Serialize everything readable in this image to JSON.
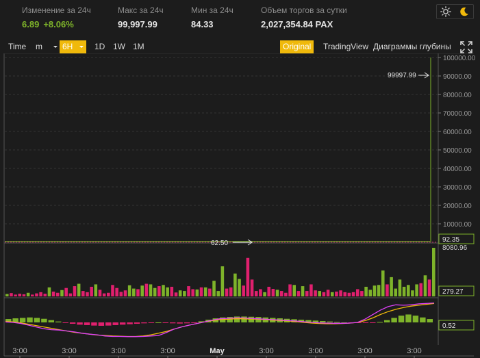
{
  "stats": [
    {
      "label": "Изменение за 24ч",
      "value": "6.89",
      "value2": "+8.06%"
    },
    {
      "label": "Макс за 24ч",
      "value": "99,997.99"
    },
    {
      "label": "Мин за 24ч",
      "value": "84.33"
    },
    {
      "label": "Объем торгов за сутки",
      "value": "2,027,354.84 PAX"
    }
  ],
  "theme_toggle": {
    "light_icon": "sun-icon",
    "dark_icon": "moon-icon"
  },
  "toolbar": {
    "time_label": "Time",
    "minute_select": "m",
    "hour_select": "6H",
    "day": "1D",
    "week": "1W",
    "month": "1M",
    "views": [
      "Original",
      "TradingView",
      "Диаграммы глубины"
    ],
    "active_view": "Original",
    "expand_icon": "expand-icon"
  },
  "colors": {
    "up": "#7eb32a",
    "down": "#e0206e",
    "accent": "#f0b90b",
    "ma_fast": "#e040fb",
    "ma_slow": "#f0b90b"
  },
  "chart_data": {
    "type": "candlestick",
    "price_axis": {
      "ticks": [
        "100000.00",
        "90000.00",
        "80000.00",
        "70000.00",
        "60000.00",
        "50000.00",
        "40000.00",
        "30000.00",
        "20000.00",
        "10000.00"
      ],
      "ylim": [
        0,
        100000
      ]
    },
    "max_marker": "99997.99",
    "min_marker": "62.50",
    "last_price": "92.35",
    "last_price_value": 92.35,
    "volume_panel": {
      "max_label": "8080.96",
      "current_label": "279.27",
      "max": 8080.96,
      "bars": [
        {
          "v": 400,
          "up": true
        },
        {
          "v": 550,
          "up": false
        },
        {
          "v": 300,
          "up": false
        },
        {
          "v": 450,
          "up": false
        },
        {
          "v": 350,
          "up": false
        },
        {
          "v": 600,
          "up": true
        },
        {
          "v": 300,
          "up": false
        },
        {
          "v": 500,
          "up": false
        },
        {
          "v": 700,
          "up": false
        },
        {
          "v": 450,
          "up": false
        },
        {
          "v": 1500,
          "up": true
        },
        {
          "v": 800,
          "up": false
        },
        {
          "v": 600,
          "up": false
        },
        {
          "v": 1050,
          "up": true
        },
        {
          "v": 1400,
          "up": false
        },
        {
          "v": 500,
          "up": false
        },
        {
          "v": 1700,
          "up": false
        },
        {
          "v": 2100,
          "up": true
        },
        {
          "v": 900,
          "up": false
        },
        {
          "v": 700,
          "up": false
        },
        {
          "v": 1600,
          "up": false
        },
        {
          "v": 2000,
          "up": true
        },
        {
          "v": 1100,
          "up": false
        },
        {
          "v": 500,
          "up": false
        },
        {
          "v": 600,
          "up": false
        },
        {
          "v": 1900,
          "up": false
        },
        {
          "v": 1400,
          "up": false
        },
        {
          "v": 750,
          "up": false
        },
        {
          "v": 1000,
          "up": false
        },
        {
          "v": 1850,
          "up": true
        },
        {
          "v": 1300,
          "up": true
        },
        {
          "v": 1200,
          "up": false
        },
        {
          "v": 1800,
          "up": true
        },
        {
          "v": 2100,
          "up": false
        },
        {
          "v": 2000,
          "up": true
        },
        {
          "v": 1400,
          "up": true
        },
        {
          "v": 1700,
          "up": false
        },
        {
          "v": 1900,
          "up": true
        },
        {
          "v": 1500,
          "up": true
        },
        {
          "v": 1600,
          "up": false
        },
        {
          "v": 650,
          "up": false
        },
        {
          "v": 1000,
          "up": true
        },
        {
          "v": 900,
          "up": true
        },
        {
          "v": 1700,
          "up": false
        },
        {
          "v": 1200,
          "up": false
        },
        {
          "v": 1150,
          "up": true
        },
        {
          "v": 1500,
          "up": false
        },
        {
          "v": 1500,
          "up": true
        },
        {
          "v": 1300,
          "up": false
        },
        {
          "v": 2600,
          "up": true
        },
        {
          "v": 900,
          "up": true
        },
        {
          "v": 5000,
          "up": true
        },
        {
          "v": 1300,
          "up": false
        },
        {
          "v": 1500,
          "up": false
        },
        {
          "v": 3800,
          "up": true
        },
        {
          "v": 2900,
          "up": true
        },
        {
          "v": 1800,
          "up": false
        },
        {
          "v": 6400,
          "up": false
        },
        {
          "v": 2800,
          "up": false
        },
        {
          "v": 900,
          "up": false
        },
        {
          "v": 1200,
          "up": false
        },
        {
          "v": 700,
          "up": true
        },
        {
          "v": 1600,
          "up": false
        },
        {
          "v": 1250,
          "up": false
        },
        {
          "v": 1100,
          "up": true
        },
        {
          "v": 900,
          "up": false
        },
        {
          "v": 600,
          "up": false
        },
        {
          "v": 2000,
          "up": false
        },
        {
          "v": 1900,
          "up": true
        },
        {
          "v": 900,
          "up": false
        },
        {
          "v": 1700,
          "up": true
        },
        {
          "v": 900,
          "up": false
        },
        {
          "v": 2000,
          "up": false
        },
        {
          "v": 1000,
          "up": false
        },
        {
          "v": 900,
          "up": true
        },
        {
          "v": 700,
          "up": false
        },
        {
          "v": 1100,
          "up": false
        },
        {
          "v": 700,
          "up": true
        },
        {
          "v": 800,
          "up": false
        },
        {
          "v": 1000,
          "up": false
        },
        {
          "v": 700,
          "up": false
        },
        {
          "v": 600,
          "up": false
        },
        {
          "v": 700,
          "up": false
        },
        {
          "v": 1200,
          "up": false
        },
        {
          "v": 900,
          "up": false
        },
        {
          "v": 1600,
          "up": true
        },
        {
          "v": 1100,
          "up": true
        },
        {
          "v": 1800,
          "up": true
        },
        {
          "v": 1900,
          "up": true
        },
        {
          "v": 4300,
          "up": true
        },
        {
          "v": 2000,
          "up": false
        },
        {
          "v": 3200,
          "up": true
        },
        {
          "v": 1300,
          "up": true
        },
        {
          "v": 2800,
          "up": true
        },
        {
          "v": 1600,
          "up": true
        },
        {
          "v": 1900,
          "up": true
        },
        {
          "v": 1000,
          "up": true
        },
        {
          "v": 2000,
          "up": true
        },
        {
          "v": 2200,
          "up": false
        },
        {
          "v": 3500,
          "up": true
        },
        {
          "v": 2800,
          "up": false
        },
        {
          "v": 8080.96,
          "up": true
        }
      ]
    },
    "macd_panel": {
      "current_label": "0.52",
      "ylim": [
        -1.0,
        1.0
      ],
      "histogram": [
        0.15,
        0.18,
        0.2,
        0.22,
        0.2,
        0.16,
        0.1,
        0.04,
        -0.02,
        -0.06,
        -0.1,
        -0.12,
        -0.14,
        -0.15,
        -0.14,
        -0.12,
        -0.1,
        -0.08,
        -0.06,
        -0.04,
        -0.02,
        0.0,
        -0.02,
        -0.04,
        -0.05,
        -0.04,
        -0.02,
        0.05,
        0.12,
        0.18,
        0.22,
        0.24,
        0.26,
        0.26,
        0.25,
        0.24,
        0.22,
        0.2,
        0.18,
        0.16,
        0.14,
        0.12,
        0.1,
        0.08,
        0.06,
        0.04,
        0.02,
        0.0,
        -0.02,
        -0.02,
        -0.03,
        -0.02,
        0.02,
        0.1,
        0.2,
        0.3,
        0.35,
        0.3,
        0.22,
        0.15
      ],
      "fast": [
        0.02,
        0.0,
        -0.05,
        -0.12,
        -0.2,
        -0.28,
        -0.32,
        -0.34,
        -0.38,
        -0.42,
        -0.48,
        -0.52,
        -0.55,
        -0.6,
        -0.62,
        -0.62,
        -0.63,
        -0.63,
        -0.62,
        -0.6,
        -0.58,
        -0.45,
        -0.3,
        -0.2,
        -0.12,
        -0.05,
        0.02,
        0.1,
        0.16,
        0.18,
        0.2,
        0.2,
        0.18,
        0.16,
        0.14,
        0.12,
        0.1,
        0.08,
        0.06,
        0.03,
        0.0,
        -0.02,
        -0.03,
        -0.04,
        -0.04,
        -0.03,
        0.0,
        0.15,
        0.35,
        0.55,
        0.7,
        0.78,
        0.76,
        0.78,
        0.82,
        0.84,
        0.86
      ],
      "slow": [
        0.05,
        0.02,
        -0.02,
        -0.08,
        -0.14,
        -0.2,
        -0.26,
        -0.32,
        -0.38,
        -0.44,
        -0.48,
        -0.52,
        -0.56,
        -0.58,
        -0.6,
        -0.61,
        -0.62,
        -0.62,
        -0.6,
        -0.55,
        -0.48,
        -0.4,
        -0.3,
        -0.2,
        -0.12,
        -0.05,
        0.02,
        0.08,
        0.12,
        0.14,
        0.16,
        0.16,
        0.15,
        0.14,
        0.12,
        0.1,
        0.08,
        0.06,
        0.03,
        0.0,
        -0.03,
        -0.05,
        -0.06,
        -0.06,
        -0.05,
        -0.03,
        0.0,
        0.08,
        0.2,
        0.35,
        0.48,
        0.58,
        0.66,
        0.72,
        0.76,
        0.8,
        0.84
      ]
    },
    "time_axis": [
      "3:00",
      "3:00",
      "3:00",
      "3:00",
      "May",
      "3:00",
      "3:00",
      "3:00",
      "3:00"
    ]
  }
}
